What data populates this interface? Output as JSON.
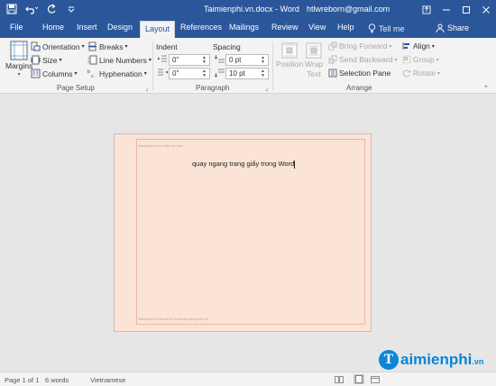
{
  "title_bar": {
    "document_title": "Taimienphi.vn.docx - Word",
    "user": "htlwreborn@gmail.com",
    "qat_icons": [
      "save-icon",
      "undo-icon",
      "redo-icon",
      "customize-icon"
    ],
    "window_icons": [
      "ribbon-display-icon",
      "minimize-icon",
      "maximize-icon",
      "close-icon"
    ]
  },
  "tabs": [
    "File",
    "Home",
    "Insert",
    "Design",
    "Layout",
    "References",
    "Mailings",
    "Review",
    "View",
    "Help"
  ],
  "active_tab": "Layout",
  "tell_me": "Tell me",
  "share": "Share",
  "ribbon": {
    "page_setup": {
      "label": "Page Setup",
      "margins": "Margins",
      "orientation": "Orientation",
      "size": "Size",
      "columns": "Columns",
      "breaks": "Breaks",
      "line_numbers": "Line Numbers",
      "hyphenation": "Hyphenation"
    },
    "paragraph": {
      "label": "Paragraph",
      "indent_label": "Indent",
      "spacing_label": "Spacing",
      "indent_left": "0\"",
      "indent_right": "0\"",
      "spacing_before": "0 pt",
      "spacing_after": "10 pt"
    },
    "arrange": {
      "label": "Arrange",
      "position": "Position",
      "wrap_text_1": "Wrap",
      "wrap_text_2": "Text",
      "bring_forward": "Bring Forward",
      "send_backward": "Send Backward",
      "selection_pane": "Selection Pane",
      "align": "Align",
      "group": "Group",
      "rotate": "Rotate"
    }
  },
  "document": {
    "header_hint": "Taimienphi.vn xin chào các bạn!",
    "body_text": "quay ngang trang giấy trong Word",
    "footer_hint": "Taimienphi.vn chia sẻ thủ thuật văn phòng hữu ích"
  },
  "status_bar": {
    "page": "Page 1 of 1",
    "words": "6 words",
    "language": "Vietnamese"
  },
  "watermark": {
    "logo_letter": "T",
    "text": "aimienphi",
    "suffix": ".vn"
  },
  "colors": {
    "word_blue": "#2b579a",
    "page_fill": "#fbe4d5",
    "ribbon_bg": "#f3f3f3",
    "canvas_bg": "#e6e6e6"
  }
}
